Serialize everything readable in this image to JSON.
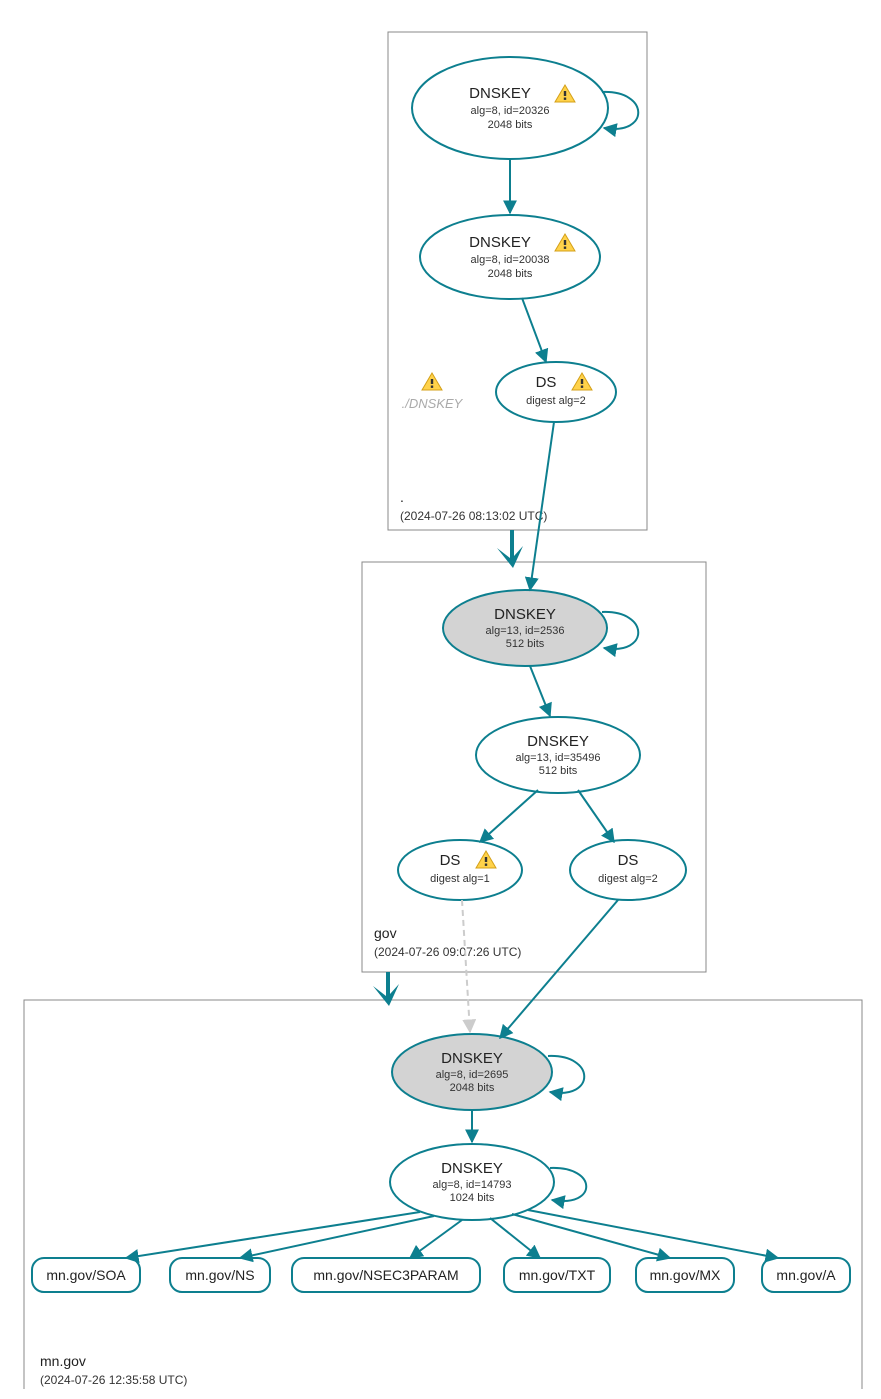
{
  "zones": {
    "root": {
      "name": ".",
      "timestamp": "(2024-07-26 08:13:02 UTC)",
      "ksk": {
        "title": "DNSKEY",
        "line1": "alg=8, id=20326",
        "line2": "2048 bits",
        "warn": true
      },
      "zsk": {
        "title": "DNSKEY",
        "line1": "alg=8, id=20038",
        "line2": "2048 bits",
        "warn": true
      },
      "ds": {
        "title": "DS",
        "line1": "digest alg=2",
        "warn": true
      },
      "missing": "./DNSKEY"
    },
    "gov": {
      "name": "gov",
      "timestamp": "(2024-07-26 09:07:26 UTC)",
      "ksk": {
        "title": "DNSKEY",
        "line1": "alg=13, id=2536",
        "line2": "512 bits",
        "warn": false
      },
      "zsk": {
        "title": "DNSKEY",
        "line1": "alg=13, id=35496",
        "line2": "512 bits",
        "warn": false
      },
      "ds1": {
        "title": "DS",
        "line1": "digest alg=1",
        "warn": true
      },
      "ds2": {
        "title": "DS",
        "line1": "digest alg=2",
        "warn": false
      }
    },
    "mn": {
      "name": "mn.gov",
      "timestamp": "(2024-07-26 12:35:58 UTC)",
      "ksk": {
        "title": "DNSKEY",
        "line1": "alg=8, id=2695",
        "line2": "2048 bits",
        "warn": false
      },
      "zsk": {
        "title": "DNSKEY",
        "line1": "alg=8, id=14793",
        "line2": "1024 bits",
        "warn": false
      },
      "records": [
        "mn.gov/SOA",
        "mn.gov/NS",
        "mn.gov/NSEC3PARAM",
        "mn.gov/TXT",
        "mn.gov/MX",
        "mn.gov/A"
      ]
    }
  }
}
